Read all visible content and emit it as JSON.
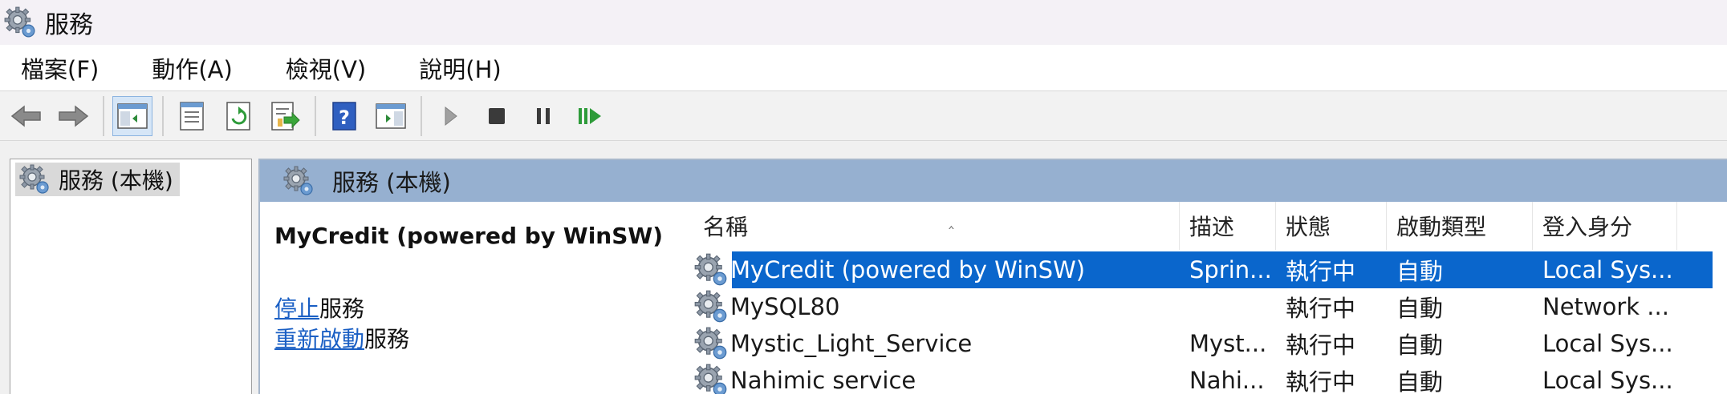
{
  "window": {
    "title": "服務"
  },
  "menu": {
    "items": [
      "檔案(F)",
      "動作(A)",
      "檢視(V)",
      "說明(H)"
    ]
  },
  "toolbar": {
    "buttons": [
      "back-icon",
      "forward-icon",
      "show-hide-console-tree-icon",
      "properties-icon",
      "refresh-icon",
      "export-list-icon",
      "help-icon",
      "show-hide-action-pane-icon",
      "start-service-icon",
      "stop-service-icon",
      "pause-service-icon",
      "resume-service-icon"
    ]
  },
  "tree": {
    "root_label": "服務 (本機)"
  },
  "pane": {
    "header": "服務 (本機)"
  },
  "details": {
    "service_name": "MyCredit (powered by WinSW)",
    "stop_link": "停止",
    "stop_suffix": "服務",
    "restart_link": "重新啟動",
    "restart_suffix": "服務"
  },
  "columns": {
    "name": "名稱",
    "description": "描述",
    "status": "狀態",
    "startup_type": "啟動類型",
    "log_on_as": "登入身分"
  },
  "rows": [
    {
      "name": "MyCredit (powered by WinSW)",
      "description": "Sprin...",
      "status": "執行中",
      "startup": "自動",
      "logon": "Local Sys...",
      "selected": true
    },
    {
      "name": "MySQL80",
      "description": "",
      "status": "執行中",
      "startup": "自動",
      "logon": "Network ..."
    },
    {
      "name": "Mystic_Light_Service",
      "description": "Myst...",
      "status": "執行中",
      "startup": "自動",
      "logon": "Local Sys..."
    },
    {
      "name": "Nahimic service",
      "description": "Nahi...",
      "status": "執行中",
      "startup": "自動",
      "logon": "Local Sys..."
    }
  ],
  "colors": {
    "selection": "#0a66cc",
    "pane_header": "#96b0d0",
    "link": "#1a5fc4"
  }
}
